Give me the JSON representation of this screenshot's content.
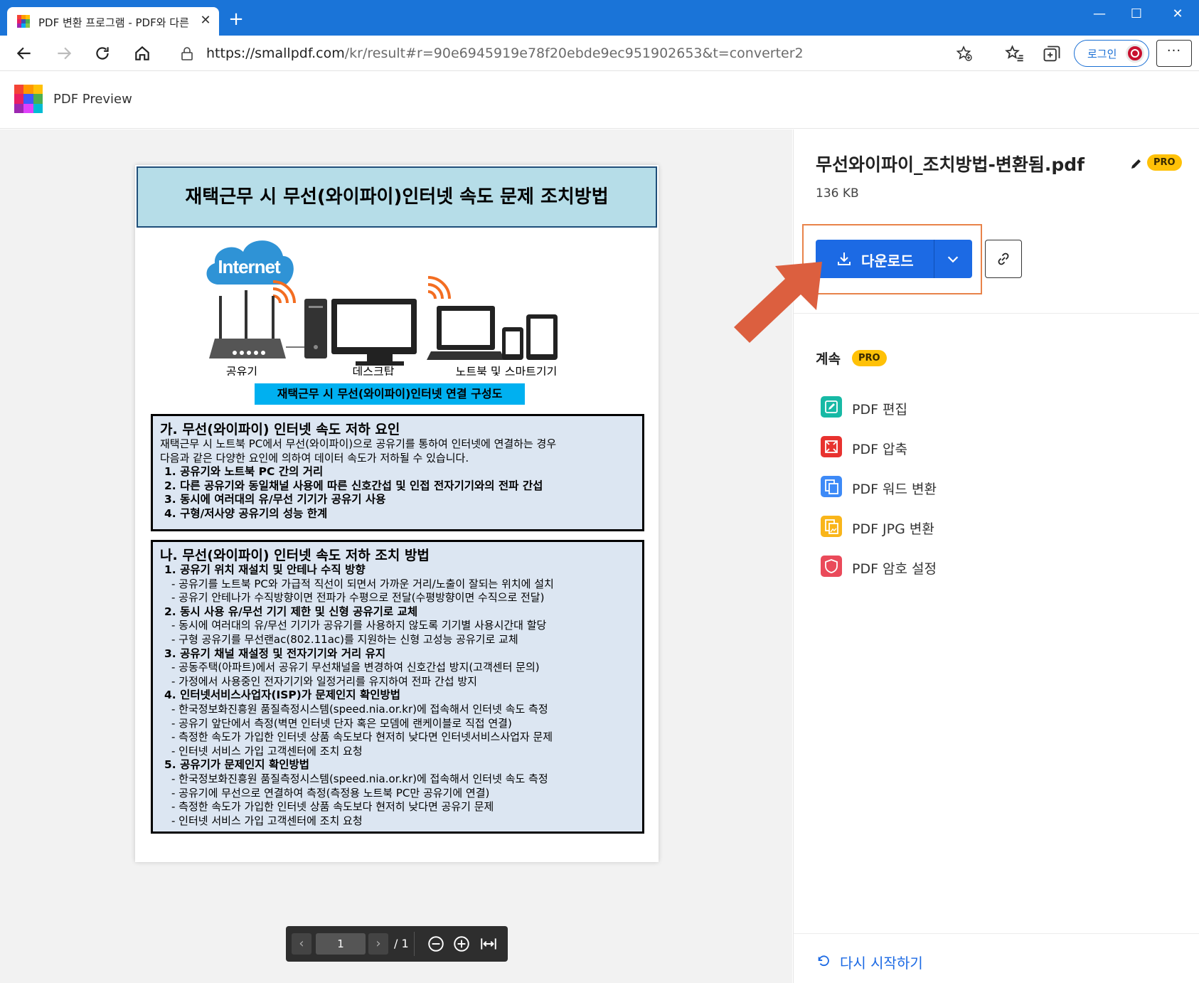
{
  "browser": {
    "tab_title": "PDF 변환 프로그램 - PDF와 다른",
    "url_base": "https://smallpdf.com",
    "url_path": "/kr/result#r=90e6945919e78f20ebde9ec951902653&t=converter2",
    "login_label": "로그인",
    "menu_label": "···"
  },
  "app": {
    "title": "PDF Preview"
  },
  "document": {
    "title": "재택근무 시 무선(와이파이)인터넷 속도 문제 조치방법",
    "labels": {
      "internet": "Internet",
      "router": "공유기",
      "desktop": "데스크탑",
      "devices": "노트북 및 스마트기기"
    },
    "caption": "재택근무 시 무선(와이파이)인터넷 연결 구성도",
    "section1": {
      "heading": "가. 무선(와이파이) 인터넷 속도 저하 요인",
      "intro1": "재택근무 시 노트북 PC에서 무선(와이파이)으로 공유기를 통하여 인터넷에 연결하는 경우",
      "intro2": "다음과 같은 다양한 요인에 의하여 데이터 속도가 저하될 수 있습니다.",
      "items": [
        "1. 공유기와 노트북 PC 간의 거리",
        "2. 다른 공유기와 동일채널 사용에 따른 신호간섭 및 인접 전자기기와의 전파 간섭",
        "3. 동시에 여러대의 유/무선 기기가 공유기 사용",
        "4. 구형/저사양 공유기의 성능 한계"
      ]
    },
    "section2": {
      "heading": "나. 무선(와이파이) 인터넷 속도 저하 조치 방법",
      "lines": [
        {
          "type": "li",
          "text": "1. 공유기 위치 재설치 및 안테나 수직 방향"
        },
        {
          "type": "sub",
          "text": "- 공유기를 노트북 PC와 가급적 직선이 되면서 가까운 거리/노출이 잘되는 위치에 설치"
        },
        {
          "type": "sub",
          "text": "- 공유기 안테나가 수직방향이면 전파가 수평으로 전달(수평방향이면 수직으로 전달)"
        },
        {
          "type": "li",
          "text": "2. 동시 사용 유/무선 기기 제한 및 신형 공유기로 교체"
        },
        {
          "type": "sub",
          "text": "- 동시에 여러대의 유/무선 기기가 공유기를 사용하지 않도록 기기별 사용시간대 할당"
        },
        {
          "type": "sub",
          "text": "- 구형 공유기를 무선랜ac(802.11ac)를 지원하는 신형 고성능 공유기로 교체"
        },
        {
          "type": "li",
          "text": "3. 공유기 채널 재설정 및 전자기기와 거리 유지"
        },
        {
          "type": "sub",
          "text": "- 공동주택(아파트)에서 공유기 무선채널을 변경하여 신호간섭 방지(고객센터 문의)"
        },
        {
          "type": "sub",
          "text": "- 가정에서 사용중인 전자기기와 일정거리를 유지하여 전파 간섭 방지"
        },
        {
          "type": "li",
          "text": "4. 인터넷서비스사업자(ISP)가 문제인지 확인방법"
        },
        {
          "type": "sub",
          "text": "- 한국정보화진흥원 품질측정시스템(speed.nia.or.kr)에 접속해서 인터넷 속도 측정"
        },
        {
          "type": "sub",
          "text": "- 공유기 앞단에서 측정(벽면 인터넷 단자 혹은 모뎀에 랜케이블로 직접 연결)"
        },
        {
          "type": "sub",
          "text": "- 측정한 속도가 가입한 인터넷 상품 속도보다 현저히 낮다면 인터넷서비스사업자 문제"
        },
        {
          "type": "sub",
          "text": "- 인터넷 서비스 가입 고객센터에 조치 요청"
        },
        {
          "type": "li",
          "text": "5. 공유기가 문제인지 확인방법"
        },
        {
          "type": "sub",
          "text": "- 한국정보화진흥원 품질측정시스템(speed.nia.or.kr)에 접속해서 인터넷 속도 측정"
        },
        {
          "type": "sub",
          "text": "- 공유기에 무선으로 연결하여 측정(측정용 노트북 PC만 공유기에 연결)"
        },
        {
          "type": "sub",
          "text": "- 측정한 속도가 가입한 인터넷 상품 속도보다 현저히 낮다면 공유기 문제"
        },
        {
          "type": "sub",
          "text": "- 인터넷 서비스 가입 고객센터에 조치 요청"
        }
      ]
    }
  },
  "pager": {
    "page": "1",
    "total": "/ 1",
    "prev": "‹",
    "next": "›"
  },
  "panel": {
    "file_name": "무선와이파이_조치방법-변환됨.pdf",
    "pro": "PRO",
    "file_size": "136 KB",
    "download_label": "다운로드",
    "continue_label": "계속",
    "tools": [
      {
        "label": "PDF 편집",
        "icon": "edit-pdf-icon",
        "color": "#17b9a5"
      },
      {
        "label": "PDF 압축",
        "icon": "compress-pdf-icon",
        "color": "#e8322f"
      },
      {
        "label": "PDF 워드 변환",
        "icon": "pdf-to-word-icon",
        "color": "#3d8af7"
      },
      {
        "label": "PDF JPG 변환",
        "icon": "pdf-to-jpg-icon",
        "color": "#f9b51a"
      },
      {
        "label": "PDF 암호 설정",
        "icon": "protect-pdf-icon",
        "color": "#ea4a5a"
      }
    ],
    "restart_label": "다시 시작하기"
  },
  "colors": {
    "browser_chrome": "#1a74d8",
    "primary": "#1c6ae4",
    "pro_badge": "#ffc107",
    "highlight_box": "#e8834a",
    "arrow": "#dc5f3f",
    "doc_title_bg": "#b6dde8",
    "doc_box_bg": "#dce6f2",
    "caption_bg": "#00b0f0"
  }
}
